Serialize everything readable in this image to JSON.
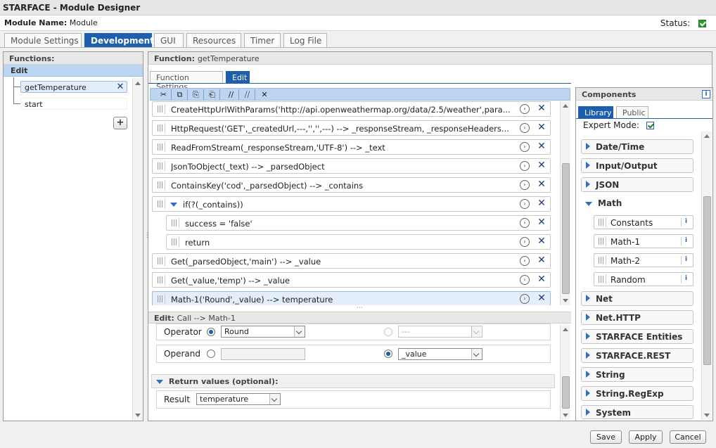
{
  "window": {
    "title": "STARFACE - Module Designer"
  },
  "module": {
    "label": "Module Name:",
    "name": "Module",
    "status_label": "Status:"
  },
  "tabs": [
    "Module Settings",
    "Development",
    "GUI",
    "Resources",
    "Timer",
    "Log File"
  ],
  "functions": {
    "header": "Functions:",
    "group": "Edit",
    "items": [
      "getTemperature",
      "start"
    ]
  },
  "function_panel": {
    "label": "Function:",
    "name": "getTemperature",
    "subtabs": [
      "Function Settings",
      "Edit"
    ]
  },
  "toolbar": {
    "icons": [
      "cut-icon",
      "copy-icon",
      "paste-icon",
      "paste-below-icon",
      "comment-icon",
      "uncomment-icon",
      "delete-icon"
    ]
  },
  "statements": [
    "CreateHttpUrlWithParams('http://api.openweathermap.org/data/2.5/weather',para...",
    "HttpRequest('GET',_createdUrl,---,'','',---) --> _responseStream, _responseHeaders...",
    "ReadFromStream(_responseStream,'UTF-8') --> _text",
    "JsonToObject(_text) --> _parsedObject",
    "ContainsKey('cod',_parsedObject) --> _contains",
    "if(?(_contains))",
    "success = 'false'",
    "return",
    "Get(_parsedObject,'main') --> _value",
    "Get(_value,'temp') --> _value",
    "Math-1('Round',_value) --> temperature"
  ],
  "edit_panel": {
    "label": "Edit:",
    "context": "Call --> Math-1",
    "operator_label": "Operator",
    "operator_value": "Round",
    "operator_alt_value": "---",
    "operand_label": "Operand",
    "operand_value": "_value",
    "return_section": "Return values (optional):",
    "result_label": "Result",
    "result_value": "temperature"
  },
  "components": {
    "header": "Components",
    "tabs": [
      "Library",
      "Public"
    ],
    "expert_label": "Expert Mode:",
    "categories_top": [
      "Date/Time",
      "Input/Output",
      "JSON",
      "Math"
    ],
    "math_items": [
      "Constants",
      "Math-1",
      "Math-2",
      "Random"
    ],
    "categories_bottom": [
      "Net",
      "Net.HTTP",
      "STARFACE Entities",
      "STARFACE.REST",
      "String",
      "String.RegExp",
      "System"
    ]
  },
  "buttons": {
    "save": "Save",
    "apply": "Apply",
    "cancel": "Cancel"
  }
}
